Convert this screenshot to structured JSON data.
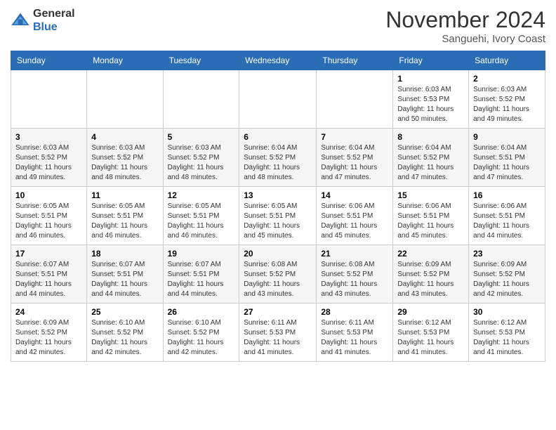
{
  "header": {
    "logo_line1": "General",
    "logo_line2": "Blue",
    "month": "November 2024",
    "location": "Sanguehi, Ivory Coast"
  },
  "days_of_week": [
    "Sunday",
    "Monday",
    "Tuesday",
    "Wednesday",
    "Thursday",
    "Friday",
    "Saturday"
  ],
  "weeks": [
    [
      {
        "day": "",
        "info": ""
      },
      {
        "day": "",
        "info": ""
      },
      {
        "day": "",
        "info": ""
      },
      {
        "day": "",
        "info": ""
      },
      {
        "day": "",
        "info": ""
      },
      {
        "day": "1",
        "info": "Sunrise: 6:03 AM\nSunset: 5:53 PM\nDaylight: 11 hours and 50 minutes."
      },
      {
        "day": "2",
        "info": "Sunrise: 6:03 AM\nSunset: 5:52 PM\nDaylight: 11 hours and 49 minutes."
      }
    ],
    [
      {
        "day": "3",
        "info": "Sunrise: 6:03 AM\nSunset: 5:52 PM\nDaylight: 11 hours and 49 minutes."
      },
      {
        "day": "4",
        "info": "Sunrise: 6:03 AM\nSunset: 5:52 PM\nDaylight: 11 hours and 48 minutes."
      },
      {
        "day": "5",
        "info": "Sunrise: 6:03 AM\nSunset: 5:52 PM\nDaylight: 11 hours and 48 minutes."
      },
      {
        "day": "6",
        "info": "Sunrise: 6:04 AM\nSunset: 5:52 PM\nDaylight: 11 hours and 48 minutes."
      },
      {
        "day": "7",
        "info": "Sunrise: 6:04 AM\nSunset: 5:52 PM\nDaylight: 11 hours and 47 minutes."
      },
      {
        "day": "8",
        "info": "Sunrise: 6:04 AM\nSunset: 5:52 PM\nDaylight: 11 hours and 47 minutes."
      },
      {
        "day": "9",
        "info": "Sunrise: 6:04 AM\nSunset: 5:51 PM\nDaylight: 11 hours and 47 minutes."
      }
    ],
    [
      {
        "day": "10",
        "info": "Sunrise: 6:05 AM\nSunset: 5:51 PM\nDaylight: 11 hours and 46 minutes."
      },
      {
        "day": "11",
        "info": "Sunrise: 6:05 AM\nSunset: 5:51 PM\nDaylight: 11 hours and 46 minutes."
      },
      {
        "day": "12",
        "info": "Sunrise: 6:05 AM\nSunset: 5:51 PM\nDaylight: 11 hours and 46 minutes."
      },
      {
        "day": "13",
        "info": "Sunrise: 6:05 AM\nSunset: 5:51 PM\nDaylight: 11 hours and 45 minutes."
      },
      {
        "day": "14",
        "info": "Sunrise: 6:06 AM\nSunset: 5:51 PM\nDaylight: 11 hours and 45 minutes."
      },
      {
        "day": "15",
        "info": "Sunrise: 6:06 AM\nSunset: 5:51 PM\nDaylight: 11 hours and 45 minutes."
      },
      {
        "day": "16",
        "info": "Sunrise: 6:06 AM\nSunset: 5:51 PM\nDaylight: 11 hours and 44 minutes."
      }
    ],
    [
      {
        "day": "17",
        "info": "Sunrise: 6:07 AM\nSunset: 5:51 PM\nDaylight: 11 hours and 44 minutes."
      },
      {
        "day": "18",
        "info": "Sunrise: 6:07 AM\nSunset: 5:51 PM\nDaylight: 11 hours and 44 minutes."
      },
      {
        "day": "19",
        "info": "Sunrise: 6:07 AM\nSunset: 5:51 PM\nDaylight: 11 hours and 44 minutes."
      },
      {
        "day": "20",
        "info": "Sunrise: 6:08 AM\nSunset: 5:52 PM\nDaylight: 11 hours and 43 minutes."
      },
      {
        "day": "21",
        "info": "Sunrise: 6:08 AM\nSunset: 5:52 PM\nDaylight: 11 hours and 43 minutes."
      },
      {
        "day": "22",
        "info": "Sunrise: 6:09 AM\nSunset: 5:52 PM\nDaylight: 11 hours and 43 minutes."
      },
      {
        "day": "23",
        "info": "Sunrise: 6:09 AM\nSunset: 5:52 PM\nDaylight: 11 hours and 42 minutes."
      }
    ],
    [
      {
        "day": "24",
        "info": "Sunrise: 6:09 AM\nSunset: 5:52 PM\nDaylight: 11 hours and 42 minutes."
      },
      {
        "day": "25",
        "info": "Sunrise: 6:10 AM\nSunset: 5:52 PM\nDaylight: 11 hours and 42 minutes."
      },
      {
        "day": "26",
        "info": "Sunrise: 6:10 AM\nSunset: 5:52 PM\nDaylight: 11 hours and 42 minutes."
      },
      {
        "day": "27",
        "info": "Sunrise: 6:11 AM\nSunset: 5:53 PM\nDaylight: 11 hours and 41 minutes."
      },
      {
        "day": "28",
        "info": "Sunrise: 6:11 AM\nSunset: 5:53 PM\nDaylight: 11 hours and 41 minutes."
      },
      {
        "day": "29",
        "info": "Sunrise: 6:12 AM\nSunset: 5:53 PM\nDaylight: 11 hours and 41 minutes."
      },
      {
        "day": "30",
        "info": "Sunrise: 6:12 AM\nSunset: 5:53 PM\nDaylight: 11 hours and 41 minutes."
      }
    ]
  ]
}
